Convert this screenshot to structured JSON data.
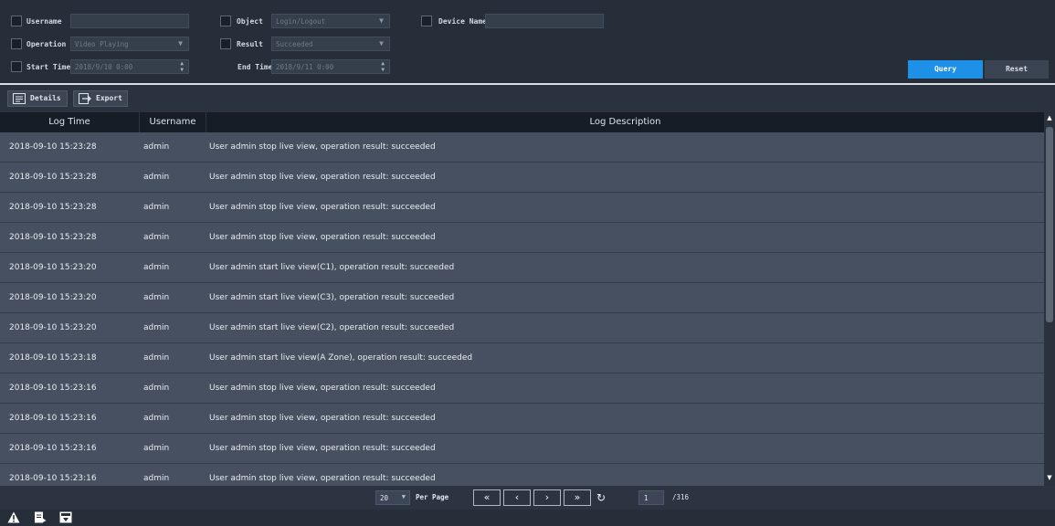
{
  "filters": {
    "username_label": "Username",
    "username_value": "",
    "object_label": "Object",
    "object_value": "Login/Logout",
    "device_name_label": "Device Name",
    "device_name_value": "",
    "operation_label": "Operation",
    "operation_value": "Video Playing",
    "result_label": "Result",
    "result_value": "Succeeded",
    "start_time_label": "Start Time",
    "start_time_value": "2018/9/10 0:00",
    "end_time_label": "End Time",
    "end_time_value": "2018/9/11 0:00",
    "query_label": "Query",
    "reset_label": "Reset"
  },
  "toolbar": {
    "details_label": "Details",
    "export_label": "Export"
  },
  "table": {
    "columns": [
      "Log Time",
      "Username",
      "Log Description"
    ],
    "rows": [
      {
        "time": "2018-09-10 15:23:28",
        "user": "admin",
        "desc": "User admin stop live view, operation result: succeeded"
      },
      {
        "time": "2018-09-10 15:23:28",
        "user": "admin",
        "desc": "User admin stop live view, operation result: succeeded"
      },
      {
        "time": "2018-09-10 15:23:28",
        "user": "admin",
        "desc": "User admin stop live view, operation result: succeeded"
      },
      {
        "time": "2018-09-10 15:23:28",
        "user": "admin",
        "desc": "User admin stop live view, operation result: succeeded"
      },
      {
        "time": "2018-09-10 15:23:20",
        "user": "admin",
        "desc": "User admin start live view(C1), operation result: succeeded"
      },
      {
        "time": "2018-09-10 15:23:20",
        "user": "admin",
        "desc": "User admin start live view(C3), operation result: succeeded"
      },
      {
        "time": "2018-09-10 15:23:20",
        "user": "admin",
        "desc": "User admin start live view(C2), operation result: succeeded"
      },
      {
        "time": "2018-09-10 15:23:18",
        "user": "admin",
        "desc": "User admin start live view(A Zone), operation result: succeeded"
      },
      {
        "time": "2018-09-10 15:23:16",
        "user": "admin",
        "desc": "User admin stop live view, operation result: succeeded"
      },
      {
        "time": "2018-09-10 15:23:16",
        "user": "admin",
        "desc": "User admin stop live view, operation result: succeeded"
      },
      {
        "time": "2018-09-10 15:23:16",
        "user": "admin",
        "desc": "User admin stop live view, operation result: succeeded"
      },
      {
        "time": "2018-09-10 15:23:16",
        "user": "admin",
        "desc": "User admin stop live view, operation result: succeeded"
      }
    ]
  },
  "pager": {
    "per_page_value": "20",
    "per_page_label": "Per Page",
    "first_icon": "double-chevron-left-icon",
    "prev_icon": "chevron-left-icon",
    "next_icon": "chevron-right-icon",
    "last_icon": "double-chevron-right-icon",
    "page_value": "1",
    "total_pages": "/316"
  },
  "bottombar": {
    "icons": [
      "warning-icon",
      "document-icon",
      "download-icon"
    ]
  },
  "colors": {
    "accent": "#1e90e8",
    "background": "#232a35",
    "row": "#465061",
    "header": "#161d27"
  }
}
